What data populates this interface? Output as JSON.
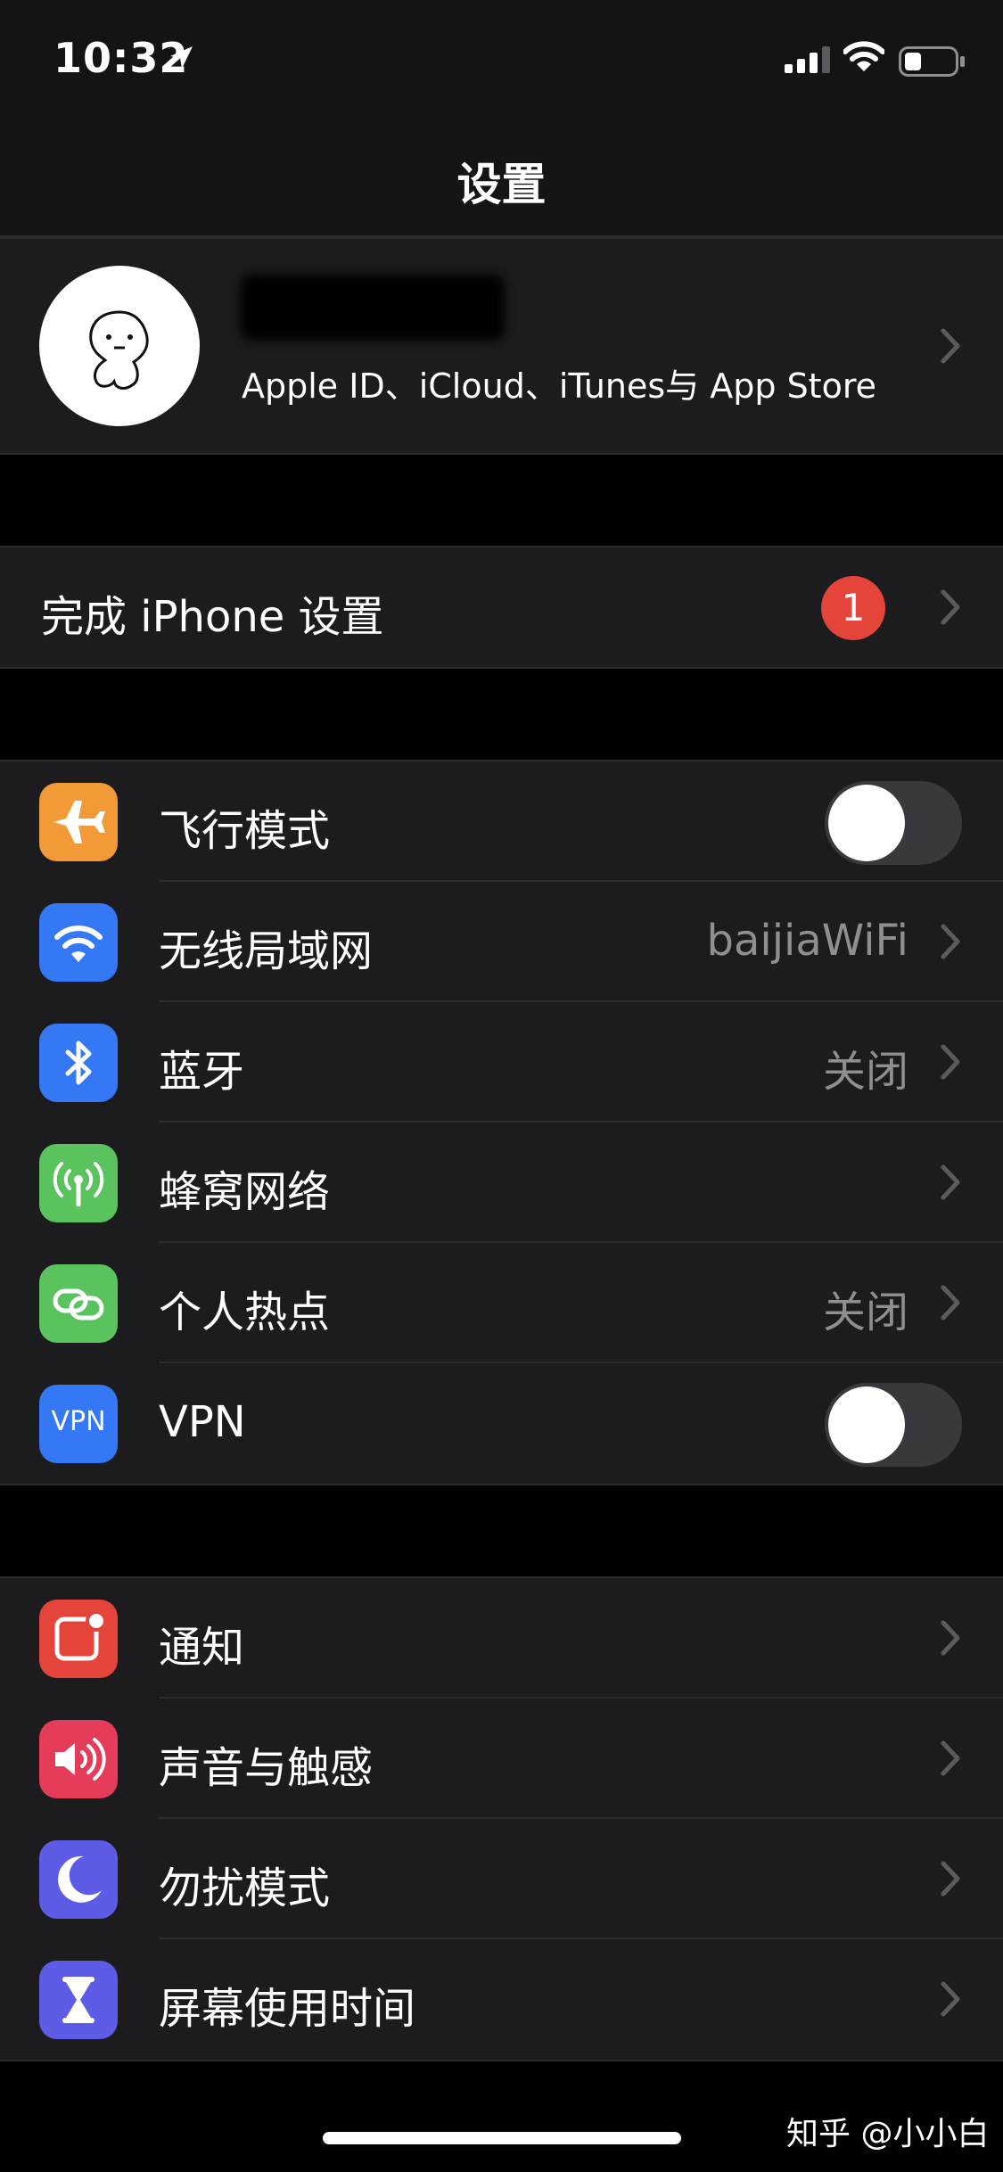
{
  "status_bar": {
    "time": "10:32"
  },
  "nav": {
    "title": "设置"
  },
  "profile": {
    "subtitle": "Apple ID、iCloud、iTunes与 App Store"
  },
  "setup": {
    "label": "完成 iPhone 设置",
    "badge": "1"
  },
  "connectivity": {
    "airplane": {
      "label": "飞行模式",
      "toggle_on": false,
      "icon": "airplane-icon",
      "color": "#f19a37"
    },
    "wifi": {
      "label": "无线局域网",
      "value": "baijiaWiFi",
      "icon": "wifi-icon",
      "color": "#3478f6"
    },
    "bluetooth": {
      "label": "蓝牙",
      "value": "关闭",
      "icon": "bluetooth-icon",
      "color": "#3478f6"
    },
    "cellular": {
      "label": "蜂窝网络",
      "icon": "antenna-icon",
      "color": "#5ac35e"
    },
    "hotspot": {
      "label": "个人热点",
      "value": "关闭",
      "icon": "hotspot-icon",
      "color": "#5ac35e"
    },
    "vpn": {
      "label": "VPN",
      "toggle_on": false,
      "icon_text": "VPN",
      "color": "#3478f6"
    }
  },
  "system": {
    "notifications": {
      "label": "通知",
      "icon": "notification-icon",
      "color": "#e5443a"
    },
    "sounds": {
      "label": "声音与触感",
      "icon": "speaker-icon",
      "color": "#e53c5a"
    },
    "dnd": {
      "label": "勿扰模式",
      "icon": "moon-icon",
      "color": "#5e5ce6"
    },
    "screen_time": {
      "label": "屏幕使用时间",
      "icon": "hourglass-icon",
      "color": "#5e5ce6"
    }
  },
  "watermark": "知乎 @小小白"
}
